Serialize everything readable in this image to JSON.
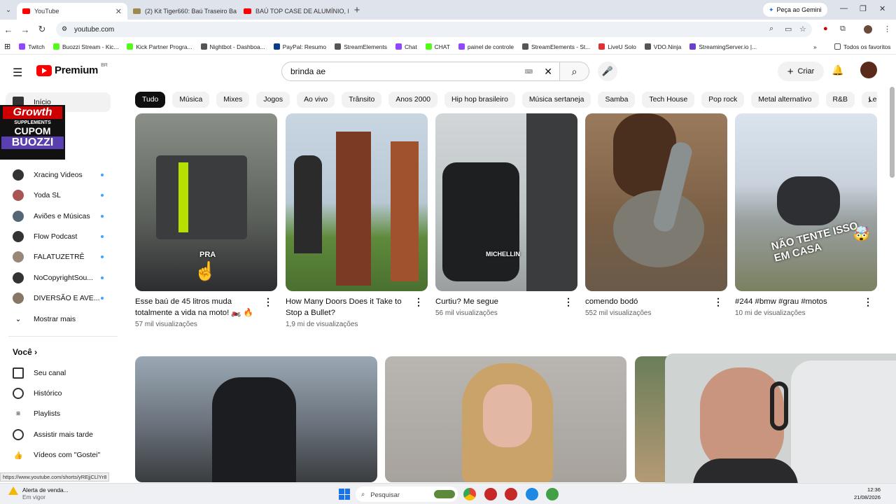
{
  "browser": {
    "tabs": [
      {
        "label": "YouTube",
        "active": true
      },
      {
        "label": "(2) Kit Tiger660: Baú Traseiro Ba",
        "active": false
      },
      {
        "label": "BAÚ TOP CASE DE ALUMÍNIO, B",
        "active": false
      }
    ],
    "gemini_label": "Peça ao Gemini",
    "url": "youtube.com",
    "bookmarks": [
      "Twitch",
      "Buozzi Stream - Kic...",
      "Kick Partner Progra...",
      "Nightbot - Dashboa...",
      "PayPal: Resumo",
      "StreamElements",
      "Chat",
      "CHAT",
      "painel de controle",
      "StreamElements - St...",
      "LiveU Solo",
      "VDO.Ninja",
      "StreamingServer.io |..."
    ],
    "all_favorites": "Todos os favoritos",
    "status_url": "https://www.youtube.com/shorts/yREjjCLlYr8"
  },
  "header": {
    "logo_text": "Premium",
    "logo_region": "BR",
    "search_value": "brinda ae",
    "create_label": "Criar"
  },
  "sidebar": {
    "home": "Início",
    "promo": {
      "line1": "Growth",
      "line2": "SUPPLEMENTS",
      "line3": "CUPOM",
      "line4": "BUOZZI"
    },
    "subscriptions": [
      {
        "label": "Xracing Videos"
      },
      {
        "label": "Yoda SL"
      },
      {
        "label": "Aviões e Músicas"
      },
      {
        "label": "Flow Podcast"
      },
      {
        "label": "FALATUZETRÊ"
      },
      {
        "label": "NoCopyrightSou..."
      },
      {
        "label": "DIVERSÃO E AVE..."
      }
    ],
    "show_more": "Mostrar mais",
    "you": "Você",
    "you_items": [
      "Seu canal",
      "Histórico",
      "Playlists",
      "Assistir mais tarde",
      "Vídeos com \"Gostei\""
    ]
  },
  "chips": [
    "Tudo",
    "Música",
    "Mixes",
    "Jogos",
    "Ao vivo",
    "Trânsito",
    "Anos 2000",
    "Hip hop brasileiro",
    "Música sertaneja",
    "Samba",
    "Tech House",
    "Pop rock",
    "Metal alternativo",
    "R&B",
    "League of L"
  ],
  "shorts": [
    {
      "title": "Esse baú de 45 litros muda totalmente a vida na moto! 🏍️ 🔥",
      "views": "57 mil visualizações",
      "caption": "PRA"
    },
    {
      "title": "How Many Doors Does it Take to Stop a Bullet?",
      "views": "1,9 mi de visualizações",
      "caption": ""
    },
    {
      "title": "Curtiu? Me segue",
      "views": "56 mil visualizações",
      "caption": "MICHELLIN"
    },
    {
      "title": "comendo bodó",
      "views": "552 mil visualizações",
      "caption": ""
    },
    {
      "title": "#244 #bmw #grau #motos",
      "views": "10 mi de visualizações",
      "caption": "NÃO TENTE ISSO EM CASA"
    }
  ],
  "taskbar": {
    "alert_title": "Alerta de venda...",
    "alert_sub": "Em vigor",
    "search_placeholder": "Pesquisar",
    "time": "12:36",
    "date": "21/08/2026"
  }
}
